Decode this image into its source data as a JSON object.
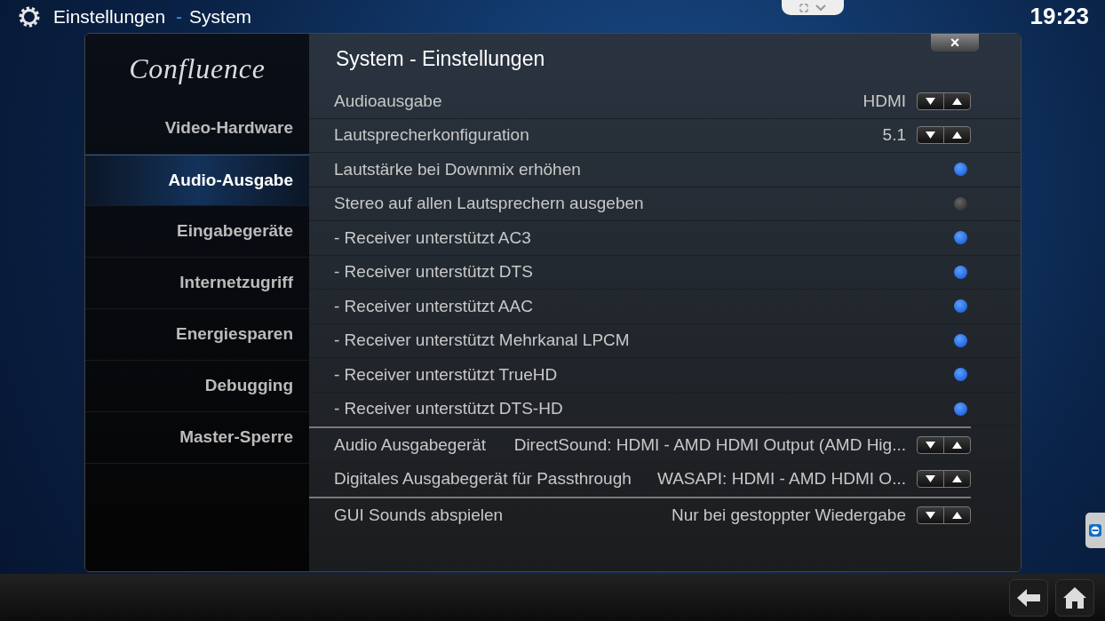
{
  "header": {
    "title": "Einstellungen",
    "separator": "-",
    "subtitle": "System",
    "clock": "19:23"
  },
  "dialog": {
    "title": "System - Einstellungen",
    "logo": "Confluence",
    "close": "×"
  },
  "sidebar": {
    "items": [
      {
        "label": "Video-Hardware",
        "selected": false
      },
      {
        "label": "Audio-Ausgabe",
        "selected": true
      },
      {
        "label": "Eingabegeräte",
        "selected": false
      },
      {
        "label": "Internetzugriff",
        "selected": false
      },
      {
        "label": "Energiesparen",
        "selected": false
      },
      {
        "label": "Debugging",
        "selected": false
      },
      {
        "label": "Master-Sperre",
        "selected": false
      }
    ]
  },
  "groups": [
    [
      {
        "kind": "spin",
        "label": "Audioausgabe",
        "value": "HDMI"
      },
      {
        "kind": "spin",
        "label": "Lautsprecherkonfiguration",
        "value": "5.1"
      },
      {
        "kind": "toggle",
        "label": "Lautstärke bei Downmix erhöhen",
        "on": true
      },
      {
        "kind": "toggle",
        "label": "Stereo auf allen Lautsprechern ausgeben",
        "on": false
      },
      {
        "kind": "toggle",
        "label": "- Receiver unterstützt AC3",
        "on": true
      },
      {
        "kind": "toggle",
        "label": "- Receiver unterstützt DTS",
        "on": true
      },
      {
        "kind": "toggle",
        "label": "- Receiver unterstützt AAC",
        "on": true
      },
      {
        "kind": "toggle",
        "label": "- Receiver unterstützt Mehrkanal LPCM",
        "on": true
      },
      {
        "kind": "toggle",
        "label": "- Receiver unterstützt TrueHD",
        "on": true
      },
      {
        "kind": "toggle",
        "label": "- Receiver unterstützt DTS-HD",
        "on": true
      }
    ],
    [
      {
        "kind": "spin",
        "label": "Audio Ausgabegerät",
        "value": "DirectSound: HDMI - AMD HDMI Output (AMD Hig..."
      },
      {
        "kind": "spin",
        "label": "Digitales Ausgabegerät für Passthrough",
        "value": "WASAPI: HDMI - AMD HDMI O..."
      }
    ],
    [
      {
        "kind": "spin",
        "label": "GUI Sounds abspielen",
        "value": "Nur bei gestoppter Wiedergabe"
      }
    ]
  ]
}
